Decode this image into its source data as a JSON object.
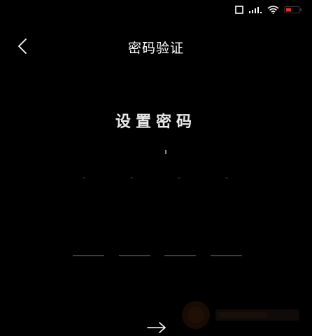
{
  "status_bar": {
    "icons": [
      "sim-icon",
      "signal-icon",
      "wifi-icon",
      "battery-icon"
    ],
    "battery_color": "#e0312b"
  },
  "header": {
    "title": "密码验证",
    "back_icon": "chevron-left-icon"
  },
  "main": {
    "subtitle": "设置密码",
    "code_length": 4
  },
  "footer": {
    "next_icon": "arrow-right-icon"
  },
  "colors": {
    "background": "#000000",
    "text": "#ffffff",
    "slot_line": "#7a7a7a"
  }
}
